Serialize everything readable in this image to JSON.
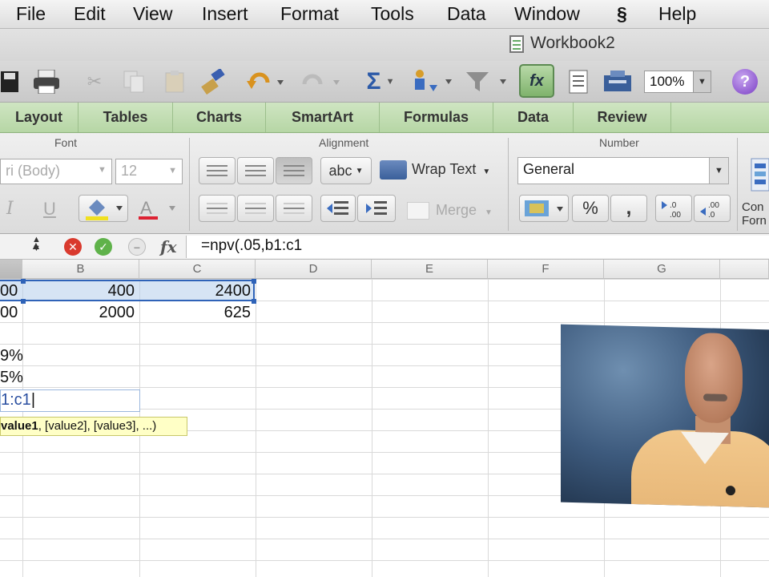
{
  "menu": {
    "items": [
      "File",
      "Edit",
      "View",
      "Insert",
      "Format",
      "Tools",
      "Data",
      "Window",
      "Help"
    ],
    "script_icon": "script-icon"
  },
  "window": {
    "title": "Workbook2"
  },
  "toolbar": {
    "zoom": "100%",
    "help_label": "?",
    "fx_label": "fx",
    "icons": [
      "save-icon",
      "print-icon",
      "cut-icon",
      "copy-icon",
      "paste-icon",
      "format-painter-icon",
      "undo-icon",
      "redo-icon",
      "autosum-icon",
      "sort-icon",
      "filter-icon",
      "formula-builder-icon",
      "gallery-icon",
      "toolbox-icon",
      "help-icon"
    ]
  },
  "ribbon": {
    "tabs": [
      "Layout",
      "Tables",
      "Charts",
      "SmartArt",
      "Formulas",
      "Data",
      "Review"
    ],
    "font": {
      "group_title": "Font",
      "font_name": "ri (Body)",
      "font_size": "12",
      "italic": "I",
      "underline": "U"
    },
    "alignment": {
      "group_title": "Alignment",
      "abc": "abc",
      "wrap_text": "Wrap Text",
      "merge": "Merge"
    },
    "number": {
      "group_title": "Number",
      "format": "General",
      "percent": "%",
      "comma": ","
    },
    "conditional": "Con Forn"
  },
  "formula_bar": {
    "formula": "=npv(.05,b1:c1",
    "cancel_icon": "cancel-icon",
    "accept_icon": "accept-icon"
  },
  "sheet": {
    "columns": [
      "B",
      "C",
      "D",
      "E",
      "F",
      "G"
    ],
    "rows": [
      {
        "a": "00",
        "b": "400",
        "c": "2400"
      },
      {
        "a": "00",
        "b": "2000",
        "c": "625"
      },
      {
        "a": "",
        "b": "",
        "c": ""
      },
      {
        "a": "9%",
        "b": "",
        "c": ""
      },
      {
        "a": "5%",
        "b": "",
        "c": ""
      }
    ],
    "editing_text": "1:c1",
    "tooltip_bold": "value1",
    "tooltip_rest": ", [value2], [value3], ...)"
  },
  "colors": {
    "ribbon_tab_bg": "#b6d6a5",
    "selection": "#2f63b8",
    "tooltip_bg": "#ffffc6"
  }
}
